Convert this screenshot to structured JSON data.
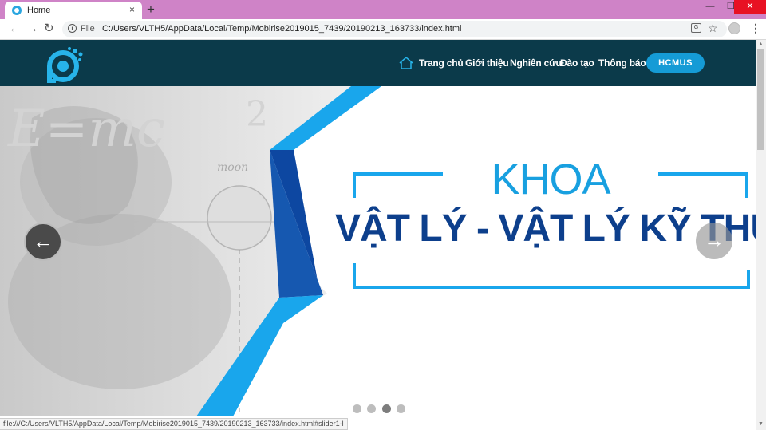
{
  "browser": {
    "tab": {
      "title": "Home",
      "close_glyph": "×"
    },
    "new_tab_glyph": "+",
    "window_controls": {
      "minimize": "—",
      "maximize": "❐",
      "close": "✕"
    },
    "toolbar": {
      "back_glyph": "←",
      "forward_glyph": "→",
      "reload_glyph": "↻",
      "info_glyph": "i",
      "file_label": "File",
      "url": "C:/Users/VLTH5/AppData/Local/Temp/Mobirise2019015_7439/20190213_163733/index.html",
      "translate_glyph": "G",
      "star_glyph": "☆",
      "menu_glyph": "⋮"
    }
  },
  "site": {
    "nav_items": [
      {
        "label": "Trang chủ"
      },
      {
        "label": "Giới thiệu"
      },
      {
        "label": "Nghiên cứu"
      },
      {
        "label": "Đào tạo"
      },
      {
        "label": "Thông báo"
      }
    ],
    "cta_label": "HCMUS",
    "colors": {
      "nav_bg": "#0b3a4a",
      "accent": "#159bd6",
      "heading_dark": "#0d3f8c",
      "heading_light": "#18a0e0"
    }
  },
  "slider": {
    "heading_line1": "KHOA",
    "heading_line2": "VẬT LÝ - VẬT LÝ KỸ THUẬT",
    "prev_glyph": "←",
    "next_glyph": "→",
    "active_index": 2,
    "dot_count": 4
  },
  "scrollbar": {
    "up_glyph": "▲",
    "down_glyph": "▼"
  },
  "status_url": "file:///C:/Users/VLTH5/AppData/Local/Temp/Mobirise2019015_7439/20190213_163733/index.html#slider1-l"
}
